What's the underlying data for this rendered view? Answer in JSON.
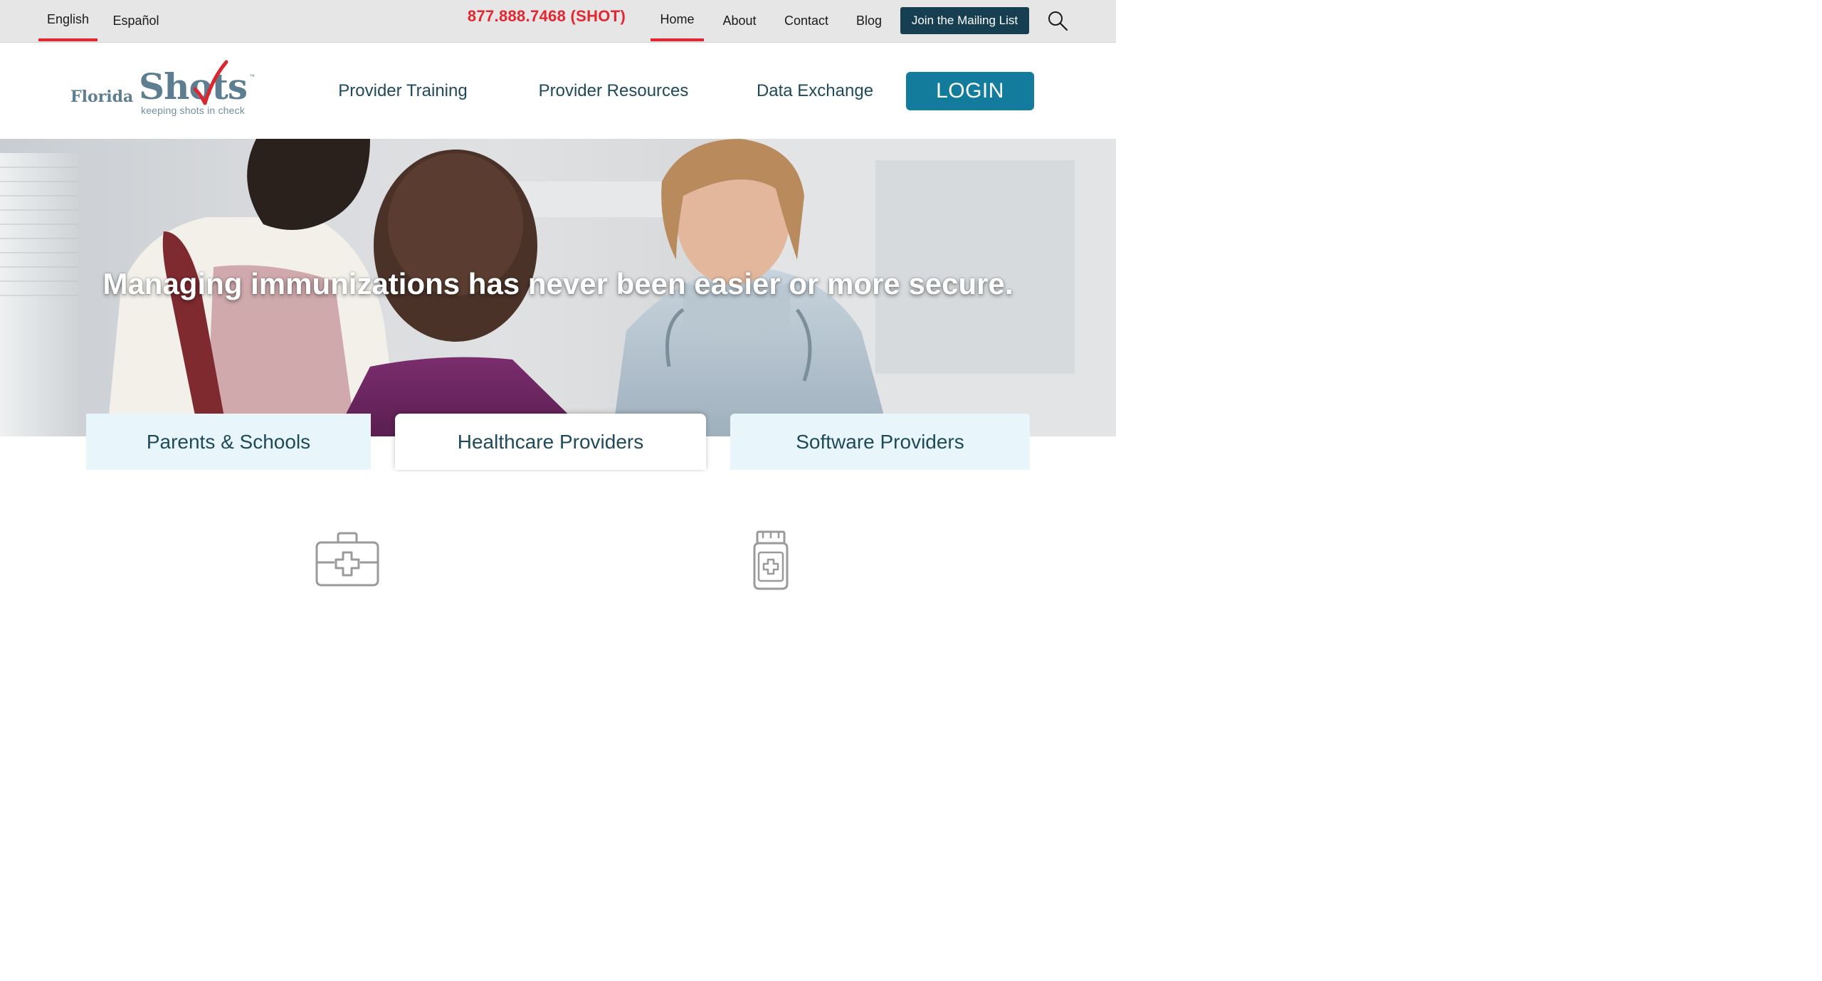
{
  "topbar": {
    "languages": [
      {
        "label": "English",
        "active": true
      },
      {
        "label": "Español",
        "active": false
      }
    ],
    "phone": "877.888.7468 (SHOT)",
    "links": [
      {
        "label": "Home",
        "active": true
      },
      {
        "label": "About",
        "active": false
      },
      {
        "label": "Contact",
        "active": false
      },
      {
        "label": "Blog",
        "active": false
      }
    ],
    "mailing_label": "Join the Mailing List",
    "search_icon": "search-icon"
  },
  "header": {
    "logo": {
      "word1": "Florida",
      "word2": "Shots",
      "tm": "™",
      "tagline": "keeping shots in check"
    },
    "nav": [
      "Provider Training",
      "Provider Resources",
      "Data Exchange"
    ],
    "login_label": "LOGIN"
  },
  "hero": {
    "headline": "Managing immunizations has never been easier or more secure."
  },
  "tabs": [
    "Parents & Schools",
    "Healthcare Providers",
    "Software Providers"
  ],
  "features": [
    {
      "icon": "medical-kit-icon"
    },
    {
      "icon": "medicine-bottle-icon"
    }
  ],
  "colors": {
    "accent_red": "#e3262f",
    "dark_navy": "#173f52",
    "login_teal": "#137c9c",
    "tab_light": "#e8f5fa",
    "text_navy": "#1e4a5a"
  }
}
